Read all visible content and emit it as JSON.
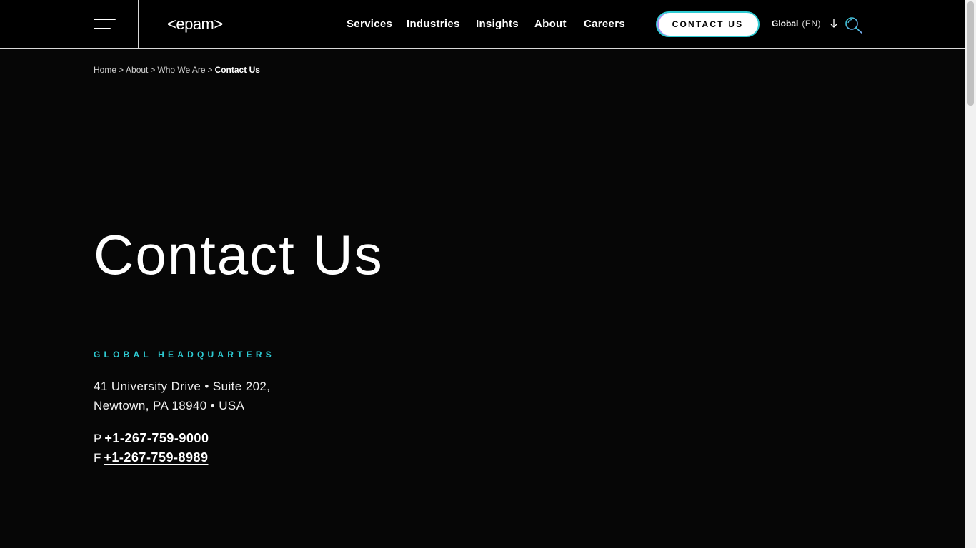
{
  "header": {
    "logo_text": "<epam>",
    "nav": [
      {
        "label": "Services"
      },
      {
        "label": "Industries"
      },
      {
        "label": "Insights"
      },
      {
        "label": "About"
      },
      {
        "label": "Careers"
      }
    ],
    "contact_button": "CONTACT US",
    "language": {
      "region": "Global",
      "code": "(EN)"
    }
  },
  "breadcrumb": {
    "items": [
      "Home",
      "About",
      "Who We Are"
    ],
    "separator": ">",
    "current": "Contact Us"
  },
  "main": {
    "title": "Contact Us",
    "hq_label": "GLOBAL HEADQUARTERS",
    "address_line1": "41 University Drive • Suite 202,",
    "address_line2": "Newtown, PA 18940 • USA",
    "phone_prefix": "P",
    "phone": "+1-267-759-9000",
    "fax_prefix": "F",
    "fax": "+1-267-759-8989"
  },
  "colors": {
    "accent": "#2ecbd3",
    "accent_secondary": "#a98bf5",
    "background": "#060606"
  }
}
